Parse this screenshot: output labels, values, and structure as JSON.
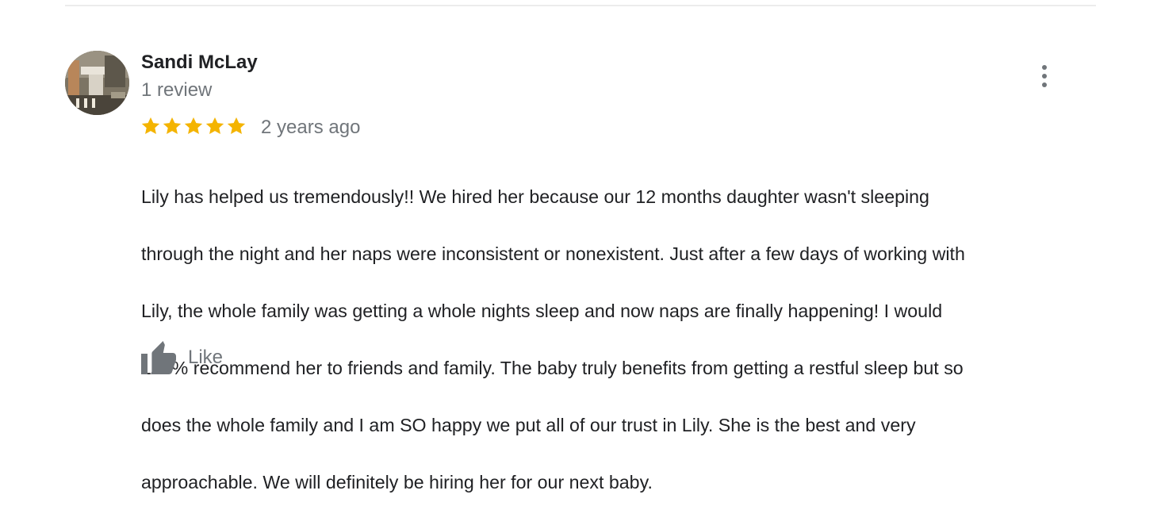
{
  "review": {
    "reviewer_name": "Sandi McLay",
    "review_count": "1 review",
    "rating": 5,
    "rating_max": 5,
    "timestamp": "2 years ago",
    "body_lines": [
      "Lily has helped us tremendously!! We hired her because our 12 months daughter wasn't sleeping",
      "through the night and her naps were inconsistent or nonexistent. Just after a few days of working with",
      "Lily, the whole family was getting a whole nights sleep and now naps are finally happening! I would",
      "100% recommend her to friends and family.  The baby truly benefits from getting a restful sleep but so",
      "does the whole family and I am SO happy we put all of our trust in Lily. She is the best and very",
      "approachable. We will definitely be hiring her for our next baby."
    ],
    "like_label": "Like"
  },
  "icons": {
    "avatar": "avatar-photo",
    "star": "star-icon",
    "more": "more-vert-icon",
    "like": "thumbs-up-icon"
  },
  "colors": {
    "star": "#f4b400",
    "secondary_text": "#70757a",
    "primary_text": "#202124",
    "divider": "#ececec"
  }
}
